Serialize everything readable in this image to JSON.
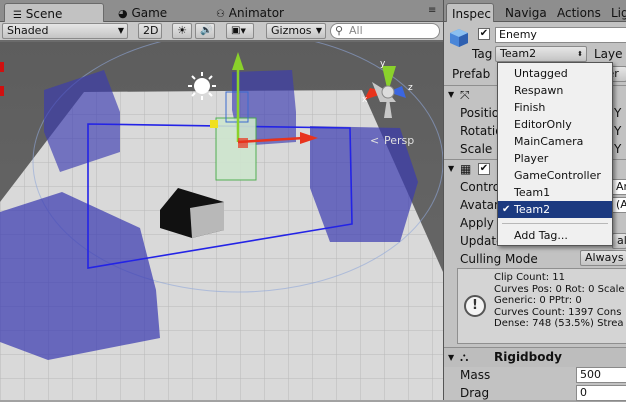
{
  "scene_tabs": [
    {
      "label": "Scene",
      "icon": "scene-icon",
      "active": true
    },
    {
      "label": "Game",
      "icon": "game-icon",
      "active": false
    },
    {
      "label": "Animator",
      "icon": "animator-icon",
      "active": false
    }
  ],
  "toolbar": {
    "shading_mode": "Shaded",
    "mode_2d": "2D",
    "gizmos": "Gizmos",
    "search_placeholder": "All"
  },
  "scene": {
    "persp_label": "Persp",
    "gizmo_axes": {
      "x": "x",
      "y": "y",
      "z": "z"
    }
  },
  "inspector_tabs": [
    "Inspec",
    "Naviga",
    "Actions",
    "Lig"
  ],
  "inspector": {
    "object_name": "Enemy",
    "tag_label": "Tag",
    "tag_value": "Team2",
    "layer_label": "Laye",
    "prefab_label": "Prefab",
    "prefab_button_fragment": "ver",
    "transform_fields": [
      "Position",
      "Rotatio",
      "Scale"
    ],
    "transform_axis": "Y",
    "animator_fields": [
      {
        "label": "Contro",
        "value": "Ar"
      },
      {
        "label": "Avatar",
        "value": "(A"
      },
      {
        "label": "Apply",
        "value": ""
      },
      {
        "label": "Update",
        "value": "al"
      }
    ],
    "culling_mode_label": "Culling Mode",
    "culling_mode_value": "Always A",
    "info_lines": [
      "Clip Count: 11",
      "Curves Pos: 0 Rot: 0 Scale",
      "Generic: 0 PPtr: 0",
      "Curves Count: 1397 Cons",
      "Dense: 748 (53.5%) Strea"
    ],
    "rigidbody": {
      "title": "Rigidbody",
      "mass_label": "Mass",
      "mass_value": "500",
      "drag_label": "Drag",
      "drag_value": "0"
    }
  },
  "tag_dropdown": {
    "items": [
      "Untagged",
      "Respawn",
      "Finish",
      "EditorOnly",
      "MainCamera",
      "Player",
      "GameController",
      "Team1",
      "Team2"
    ],
    "selected": "Team2",
    "add_tag": "Add Tag..."
  },
  "colors": {
    "selection": "#1c3a80",
    "axis_x": "#e8331c",
    "axis_y": "#8ad12b",
    "axis_z": "#3b66e0",
    "volume_blue": "#3a3ab0"
  }
}
